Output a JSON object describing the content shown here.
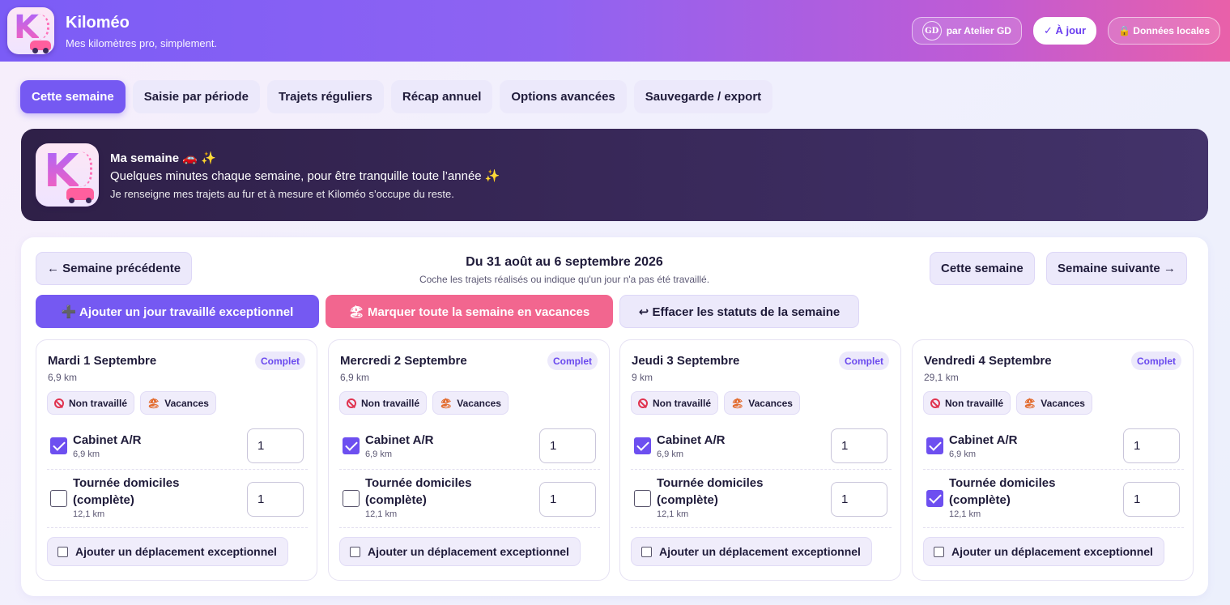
{
  "header": {
    "title": "Kiloméo",
    "subtitle": "Mes kilomètres pro, simplement.",
    "logo_letter": "K",
    "maker_label": "par Atelier GD",
    "maker_icon_text": "GD",
    "update_label": "✓ À jour",
    "local_data_label": "🔒 Données locales"
  },
  "tabs": [
    {
      "label": "Cette semaine",
      "active": true
    },
    {
      "label": "Saisie par période"
    },
    {
      "label": "Trajets réguliers"
    },
    {
      "label": "Récap annuel"
    },
    {
      "label": "Options avancées"
    },
    {
      "label": "Sauvegarde / export"
    }
  ],
  "banner": {
    "title": "Ma semaine 🚗 ✨",
    "line": "Quelques minutes chaque semaine, pour être tranquille toute l’année ✨",
    "small": "Je renseigne mes trajets au fur et à mesure et Kiloméo s’occupe du reste."
  },
  "week": {
    "prev_label": "← Semaine précédente",
    "title": "Du 31 août au 6 septembre 2026",
    "subtitle": "Coche les trajets réalisés ou indique qu'un jour n'a pas été travaillé.",
    "current_label": "Cette semaine",
    "next_label": "Semaine suivante →",
    "add_day_label": "➕ Ajouter un jour travaillé exceptionnel",
    "vacation_label": "🏖 Marquer toute la semaine en vacances",
    "clear_label": "↩ Effacer les statuts de la semaine"
  },
  "labels": {
    "not_worked": "Non travaillé",
    "vacation": "Vacances",
    "vacation_icon": "🏖",
    "add_trip": "Ajouter un déplacement exceptionnel"
  },
  "days": [
    {
      "name": "Mardi 1 Septembre",
      "km": "6,9 km",
      "badge": "Complet",
      "trips": [
        {
          "name": "Cabinet A/R",
          "km": "6,9 km",
          "qty": "1",
          "checked": true
        },
        {
          "name": "Tournée domiciles (complète)",
          "km": "12,1 km",
          "qty": "1",
          "checked": false
        }
      ]
    },
    {
      "name": "Mercredi 2 Septembre",
      "km": "6,9 km",
      "badge": "Complet",
      "trips": [
        {
          "name": "Cabinet A/R",
          "km": "6,9 km",
          "qty": "1",
          "checked": true
        },
        {
          "name": "Tournée domiciles (complète)",
          "km": "12,1 km",
          "qty": "1",
          "checked": false
        }
      ]
    },
    {
      "name": "Jeudi 3 Septembre",
      "km": "9 km",
      "badge": "Complet",
      "trips": [
        {
          "name": "Cabinet A/R",
          "km": "6,9 km",
          "qty": "1",
          "checked": true
        },
        {
          "name": "Tournée domiciles (complète)",
          "km": "12,1 km",
          "qty": "1",
          "checked": false
        }
      ]
    },
    {
      "name": "Vendredi 4 Septembre",
      "km": "29,1 km",
      "badge": "Complet",
      "trips": [
        {
          "name": "Cabinet A/R",
          "km": "6,9 km",
          "qty": "1",
          "checked": true
        },
        {
          "name": "Tournée domiciles (complète)",
          "km": "12,1 km",
          "qty": "1",
          "checked": true
        }
      ]
    }
  ],
  "colors": {
    "accent": "#7559f2",
    "pink": "#f2668f",
    "banner_bg": "#33234f"
  }
}
